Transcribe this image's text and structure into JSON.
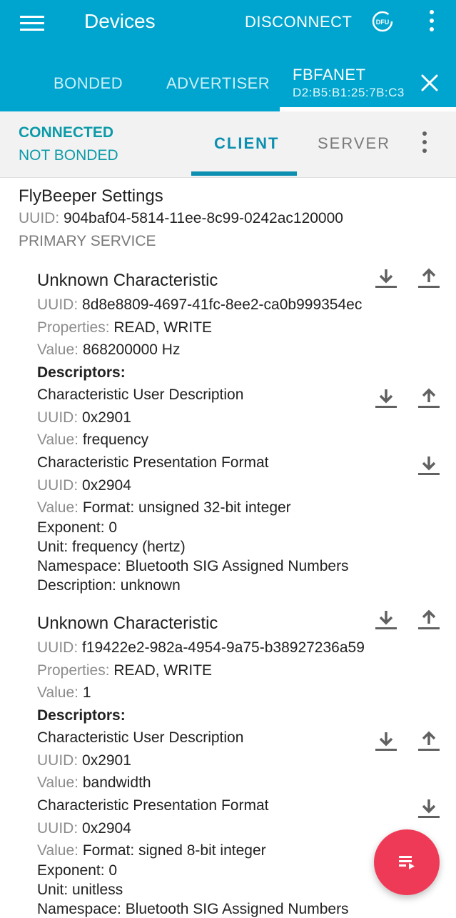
{
  "appbar": {
    "title": "Devices",
    "disconnect": "DISCONNECT",
    "dfu_label": "DFU",
    "tabs": [
      {
        "label": "BONDED"
      },
      {
        "label": "ADVERTISER"
      }
    ],
    "device": {
      "name": "FBFANET",
      "address": "D2:B5:B1:25:7B:C3"
    }
  },
  "subbar": {
    "status_connection": "CONNECTED",
    "status_bond": "NOT BONDED",
    "tab_client": "CLIENT",
    "tab_server": "SERVER"
  },
  "service": {
    "name": "FlyBeeper Settings",
    "uuid_label": "UUID:",
    "uuid": "904baf04-5814-11ee-8c99-0242ac120000",
    "type": "PRIMARY SERVICE"
  },
  "labels": {
    "uuid": "UUID:",
    "properties": "Properties:",
    "value": "Value:",
    "descriptors": "Descriptors:"
  },
  "characteristics": [
    {
      "title": "Unknown Characteristic",
      "uuid": "8d8e8809-4697-41fc-8ee2-ca0b999354ec",
      "properties": "READ, WRITE",
      "value": "868200000 Hz",
      "descriptors": [
        {
          "title": "Characteristic User Description",
          "uuid": "0x2901",
          "value": "frequency"
        },
        {
          "title": "Characteristic Presentation Format",
          "uuid": "0x2904",
          "value": "Format: unsigned 32-bit integer",
          "extra": [
            "Exponent: 0",
            "Unit: frequency (hertz)",
            "Namespace: Bluetooth SIG Assigned Numbers",
            "Description: unknown"
          ]
        }
      ]
    },
    {
      "title": "Unknown Characteristic",
      "uuid": "f19422e2-982a-4954-9a75-b38927236a59",
      "properties": "READ, WRITE",
      "value": "1",
      "descriptors": [
        {
          "title": "Characteristic User Description",
          "uuid": "0x2901",
          "value": "bandwidth"
        },
        {
          "title": "Characteristic Presentation Format",
          "uuid": "0x2904",
          "value": "Format: signed 8-bit integer",
          "extra": [
            "Exponent: 0",
            "Unit: unitless",
            "Namespace: Bluetooth SIG Assigned Numbers"
          ]
        }
      ]
    }
  ],
  "colors": {
    "appbar": "#00a5cf",
    "accent": "#0c8fb0",
    "fab": "#ef3a57"
  }
}
